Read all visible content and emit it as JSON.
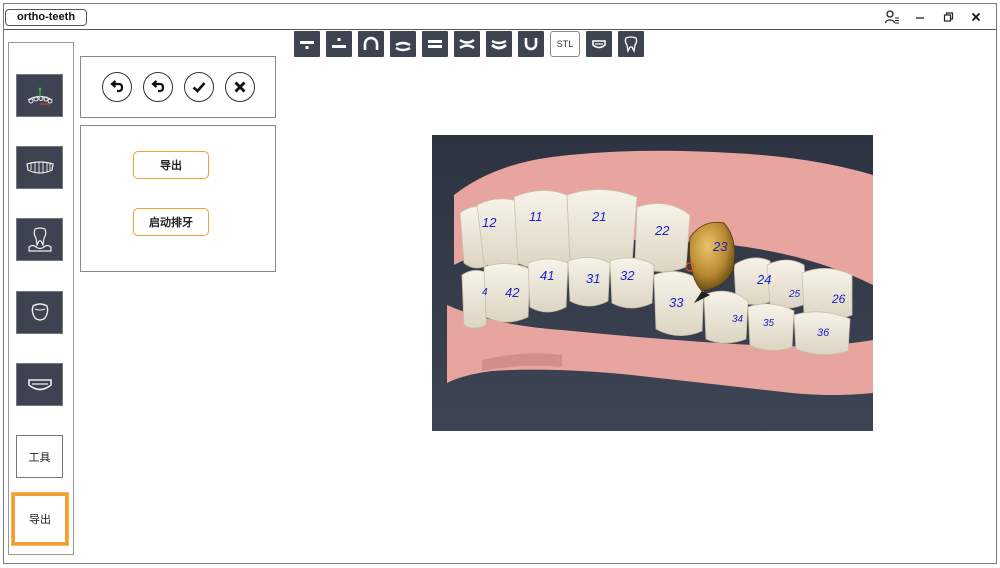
{
  "window": {
    "title": "ortho-teeth"
  },
  "window_controls": [
    {
      "name": "user-icon"
    },
    {
      "name": "minimize-icon",
      "glyph": "–"
    },
    {
      "name": "restore-icon"
    },
    {
      "name": "close-icon",
      "glyph": "×"
    }
  ],
  "toolbar": {
    "items": [
      {
        "name": "plane-below-icon"
      },
      {
        "name": "plane-above-icon"
      },
      {
        "name": "arch-icon"
      },
      {
        "name": "lower-jaw-icon"
      },
      {
        "name": "equal-icon"
      },
      {
        "name": "bite-icon"
      },
      {
        "name": "upper-jaw-icon"
      },
      {
        "name": "u-arch-icon"
      },
      {
        "name": "stl-button",
        "label": "STL"
      },
      {
        "name": "aligner-icon"
      },
      {
        "name": "tooth-outline-icon"
      }
    ]
  },
  "sidebar": {
    "icon_buttons": [
      {
        "name": "axis-teeth-icon"
      },
      {
        "name": "full-arch-icon"
      },
      {
        "name": "gum-tooth-icon"
      },
      {
        "name": "crown-icon"
      },
      {
        "name": "aligner-tray-icon"
      }
    ],
    "tools_label": "工具",
    "export_label": "导出"
  },
  "actions": [
    {
      "name": "undo-icon"
    },
    {
      "name": "redo-icon"
    },
    {
      "name": "confirm-icon"
    },
    {
      "name": "cancel-icon"
    }
  ],
  "export_panel": {
    "export_button": "导出",
    "start_arrange_button": "启动排牙"
  },
  "colors": {
    "dark_button": "#3d4350",
    "accent_orange": "#f0a030",
    "gum": "#e8a5a0",
    "tooth": "#efe9db",
    "selected_tooth": "#c99a3e",
    "tooth_label": "#1a22c8",
    "viewport_bg": "#333a48"
  },
  "teeth_labels": [
    "12",
    "11",
    "21",
    "22",
    "23",
    "42",
    "41",
    "31",
    "32",
    "33",
    "24",
    "25",
    "26",
    "34",
    "35",
    "36",
    "4"
  ]
}
